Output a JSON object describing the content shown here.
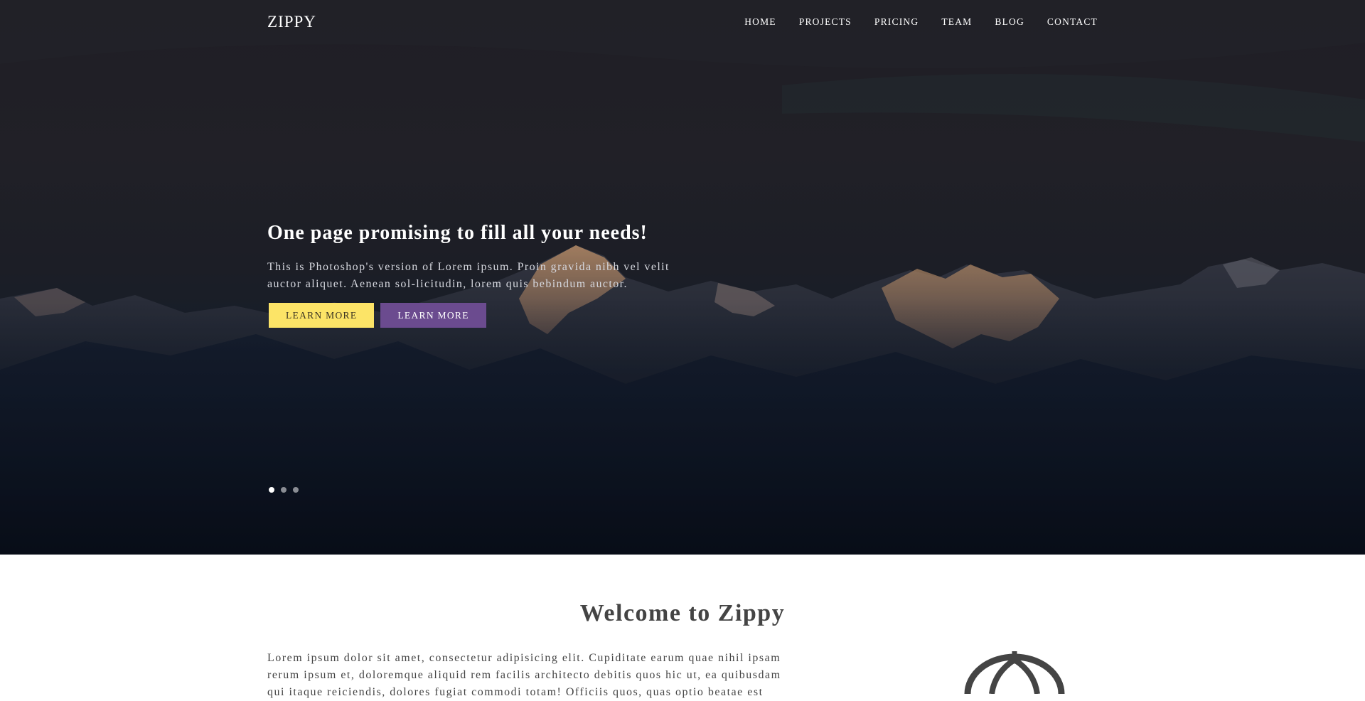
{
  "header": {
    "brand": "ZIPPY",
    "nav": [
      {
        "label": "HOME"
      },
      {
        "label": "PROJECTS"
      },
      {
        "label": "PRICING"
      },
      {
        "label": "TEAM"
      },
      {
        "label": "BLOG"
      },
      {
        "label": "CONTACT"
      }
    ]
  },
  "hero": {
    "title": "One page promising to fill all your needs!",
    "text": "This is Photoshop's version of Lorem ipsum. Proin gravida nibh vel velit auctor aliquet. Aenean sol-licitudin, lorem quis bebindum auctor.",
    "buttons": {
      "primary": "LEARN MORE",
      "secondary": "LEARN MORE"
    },
    "slides": {
      "count": 3,
      "active": 1
    }
  },
  "welcome": {
    "title": "Welcome to Zippy",
    "text": "Lorem ipsum dolor sit amet, consectetur adipisicing elit. Cupiditate earum quae nihil ipsam rerum ipsum et, doloremque aliquid rem facilis architecto debitis quos hic ut, ea quibusdam qui itaque reiciendis, dolores fugiat commodi totam! Officiis quos, quas optio beatae est",
    "icon": "umbrella-icon"
  },
  "colors": {
    "yellow_button": "#fce467",
    "purple_button": "#6b4b8f",
    "heading_text": "#444444"
  }
}
